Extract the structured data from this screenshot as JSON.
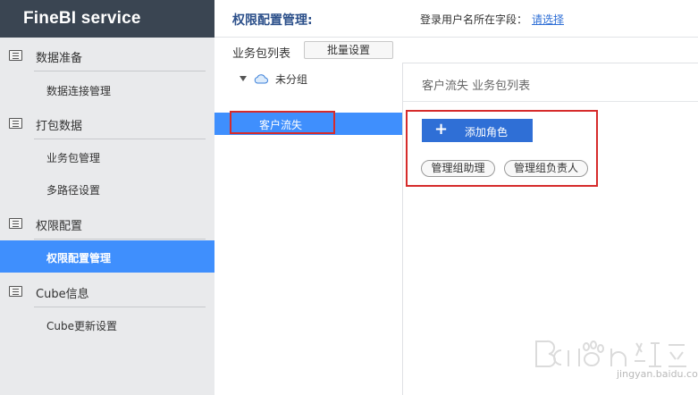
{
  "app": {
    "title": "FineBI service"
  },
  "sidebar": {
    "groups": [
      {
        "label": "数据准备",
        "items": [
          {
            "label": "数据连接管理"
          }
        ]
      },
      {
        "label": "打包数据",
        "items": [
          {
            "label": "业务包管理"
          },
          {
            "label": "多路径设置"
          }
        ]
      },
      {
        "label": "权限配置",
        "items": [
          {
            "label": "权限配置管理",
            "active": true
          }
        ]
      },
      {
        "label": "Cube信息",
        "items": [
          {
            "label": "Cube更新设置"
          }
        ]
      }
    ]
  },
  "header": {
    "title": "权限配置管理:",
    "field_label": "登录用户名所在字段：",
    "field_link": "请选择"
  },
  "package_list": {
    "title": "业务包列表",
    "batch_button": "批量设置",
    "group": {
      "label": "未分组",
      "icon": "cloud-icon",
      "expanded": true
    },
    "selected_item": "客户流失"
  },
  "panel": {
    "title": "客户流失 业务包列表",
    "add_role_label": "添加角色",
    "add_role_icon": "plus-icon",
    "roles": [
      "管理组助理",
      "管理组负责人"
    ]
  },
  "watermark": {
    "logo": "Baidu经验",
    "url": "jingyan.baidu.com"
  },
  "colors": {
    "accent": "#3f8ffd",
    "primary_button": "#2f6fd6",
    "brand_bar": "#3a4552",
    "highlight_box": "#d62b2b"
  }
}
